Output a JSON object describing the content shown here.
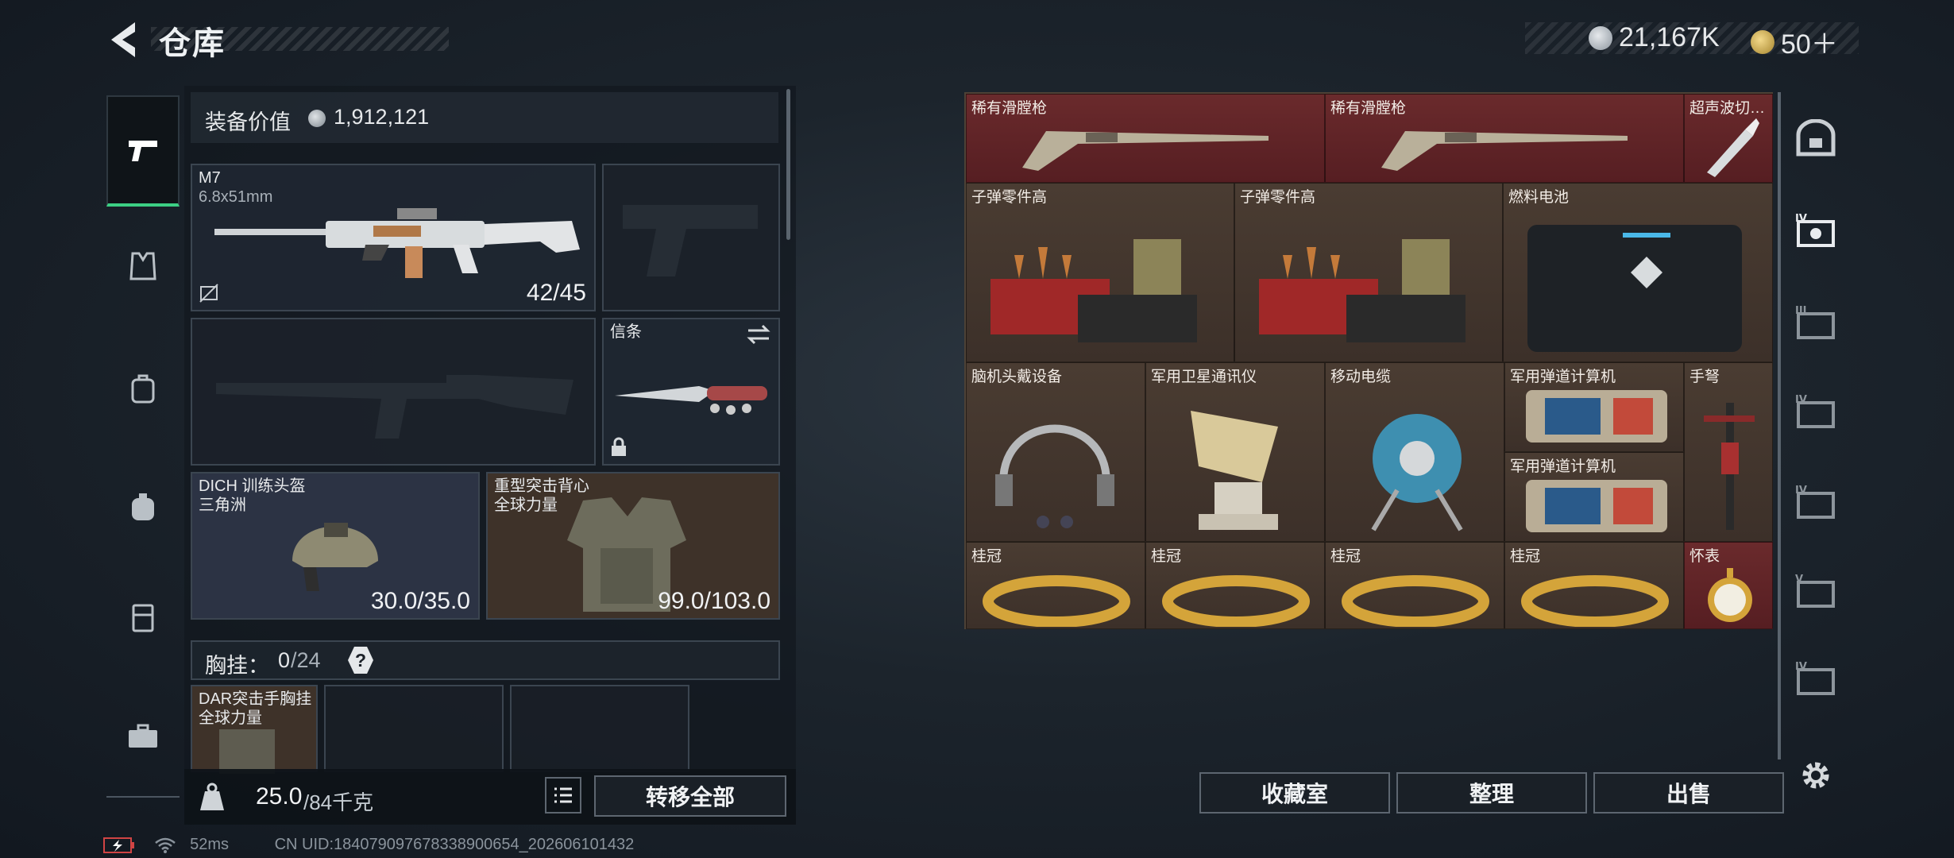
{
  "header": {
    "title": "仓库",
    "back_icon": "back-arrow-icon",
    "currency_1": {
      "icon": "silver-coin-icon",
      "value": "21,167K"
    },
    "currency_2": {
      "icon": "gold-coin-icon",
      "value": "50＋"
    }
  },
  "left_sidebar": {
    "items": [
      {
        "icon": "pistol-icon",
        "active": true
      },
      {
        "icon": "vest-icon"
      },
      {
        "icon": "backpack-small-icon"
      },
      {
        "icon": "backpack-icon"
      },
      {
        "icon": "rig-icon"
      },
      {
        "icon": "toolbox-icon"
      }
    ]
  },
  "loadout": {
    "value_label": "装备价值",
    "value": "1,912,121",
    "primary_weapon": {
      "name": "M7",
      "caliber": "6.8x51mm",
      "ammo": "42/45"
    },
    "sidearm": {
      "name": ""
    },
    "secondary_weapon": {
      "name": ""
    },
    "melee": {
      "name": "信条"
    },
    "helmet": {
      "name": "DICH 训练头盔",
      "faction": "三角洲",
      "durability": "30.0/35.0"
    },
    "armor": {
      "name": "重型突击背心",
      "faction": "全球力量",
      "durability": "99.0/103.0"
    },
    "chest_rig": {
      "label": "胸挂：",
      "count": "0",
      "capacity": "/24",
      "help": "?"
    },
    "rig_item": {
      "name": "DAR突击手胸挂",
      "faction": "全球力量"
    },
    "weight": {
      "current": "25.0",
      "max": "/84千克"
    },
    "transfer_all": "转移全部"
  },
  "stash_items": [
    {
      "label": "稀有滑膛枪",
      "color": "red"
    },
    {
      "label": "稀有滑膛枪",
      "color": "red"
    },
    {
      "label": "超声波切…",
      "color": "red"
    },
    {
      "label": "子弹零件高",
      "color": "brown"
    },
    {
      "label": "子弹零件高",
      "color": "brown"
    },
    {
      "label": "燃料电池",
      "color": "brown"
    },
    {
      "label": "脑机头戴设备",
      "color": "brown"
    },
    {
      "label": "军用卫星通讯仪",
      "color": "brown"
    },
    {
      "label": "移动电缆",
      "color": "brown"
    },
    {
      "label": "军用弹道计算机",
      "color": "brown"
    },
    {
      "label": "军用弹道计算机",
      "color": "brown"
    },
    {
      "label": "手弩",
      "color": "brown"
    },
    {
      "label": "桂冠",
      "color": "brown"
    },
    {
      "label": "桂冠",
      "color": "brown"
    },
    {
      "label": "桂冠",
      "color": "brown"
    },
    {
      "label": "桂冠",
      "color": "brown"
    },
    {
      "label": "怀表",
      "color": "red"
    }
  ],
  "right_sidebar": {
    "items": [
      {
        "icon": "vault-icon"
      },
      {
        "icon": "storage-tier-iv-icon",
        "label": "IV"
      },
      {
        "icon": "storage-tier-iii-icon",
        "label": "III"
      },
      {
        "icon": "storage-tier-iv-icon-2",
        "label": "IV"
      },
      {
        "icon": "storage-tier-iv-icon-3",
        "label": "IV"
      },
      {
        "icon": "storage-tier-v-icon",
        "label": "V"
      },
      {
        "icon": "storage-tier-iv-icon-4",
        "label": "IV"
      }
    ],
    "settings_icon": "gear-icon"
  },
  "bottom_buttons": {
    "collection": "收藏室",
    "sort": "整理",
    "sell": "出售"
  },
  "status_bar": {
    "ping": "52ms",
    "uid": "CN UID:184079097678338900654_202606101432"
  },
  "colors": {
    "accent_green": "#3ccf84",
    "item_red": "#5e2226",
    "item_brown": "#3e3229"
  }
}
